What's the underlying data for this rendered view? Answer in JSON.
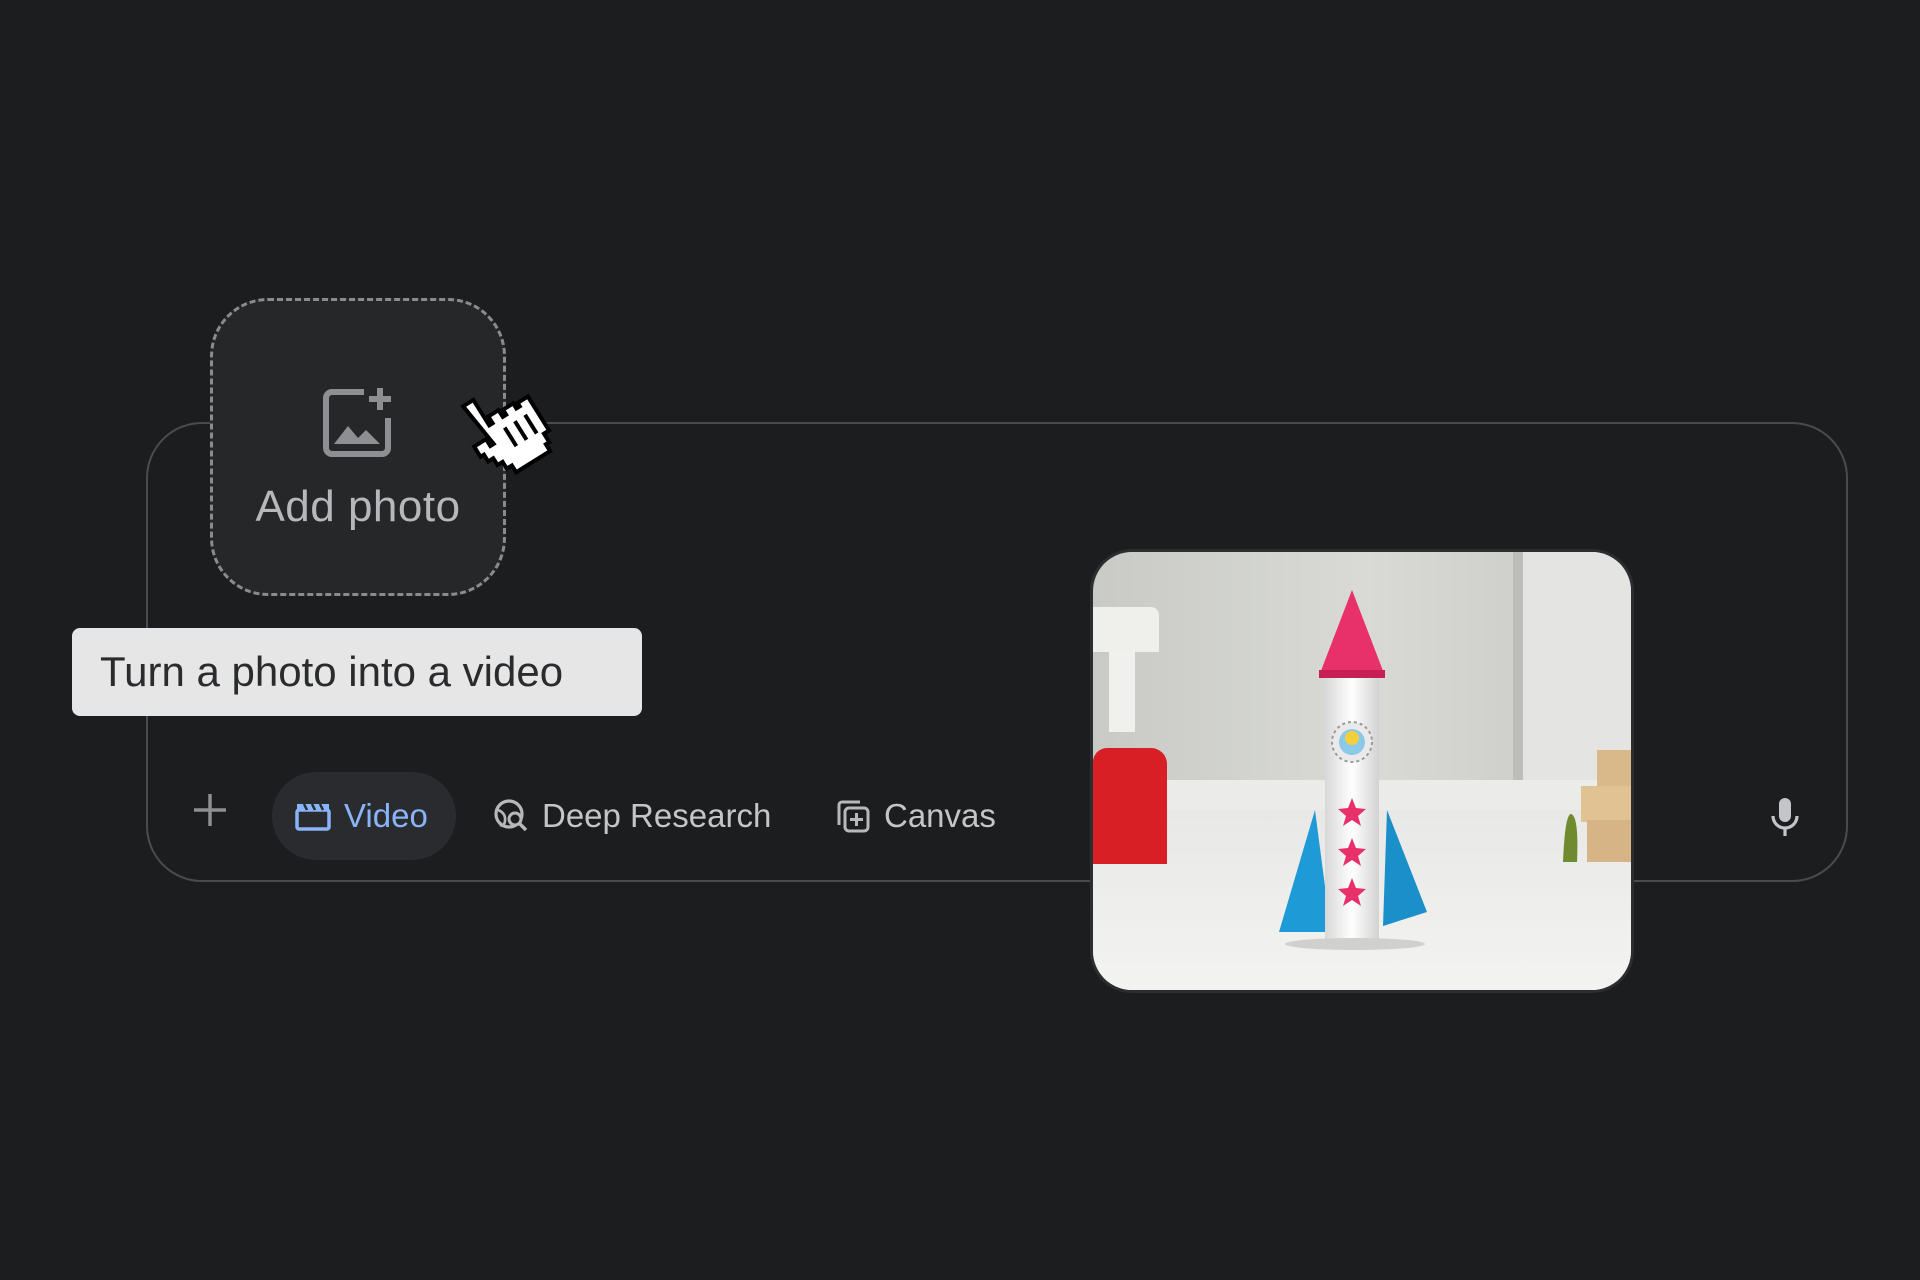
{
  "add_photo": {
    "label": "Add photo",
    "icon": "add-image-icon"
  },
  "tooltip": {
    "text": "Turn a photo into a video"
  },
  "toolbar": {
    "plus_icon": "plus-icon",
    "video": {
      "label": "Video",
      "icon": "clapperboard-icon",
      "active": true
    },
    "deep_research": {
      "label": "Deep Research",
      "icon": "deep-research-icon"
    },
    "canvas": {
      "label": "Canvas",
      "icon": "canvas-icon"
    },
    "mic_icon": "microphone-icon"
  },
  "photo_preview": {
    "subject": "paper rocket toy photo"
  },
  "colors": {
    "background": "#1c1d1f",
    "accent": "#8ab4f8",
    "chip_active_bg": "#2a2b2e",
    "tooltip_bg": "#e6e6e6"
  }
}
